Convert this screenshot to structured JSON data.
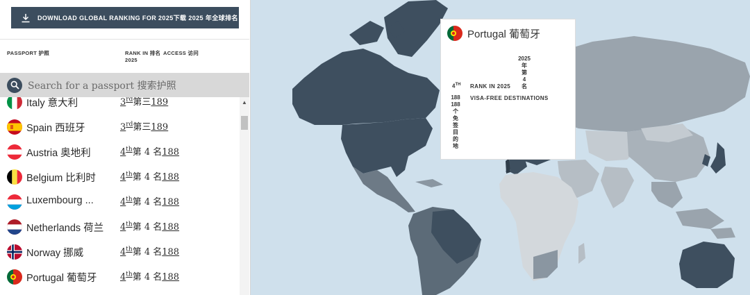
{
  "download_button": {
    "label": "DOWNLOAD GLOBAL RANKING FOR 2025下载 2025 年全球排名"
  },
  "table_header": {
    "passport": "PASSPORT 护照",
    "rank": "RANK IN 排名",
    "access": "ACCESS 访问",
    "year": "2025"
  },
  "search": {
    "placeholder": "Search for a passport 搜索护照"
  },
  "passports": [
    {
      "name": "Italy 意大利",
      "rank_num": "3",
      "rank_suffix": "rd",
      "rank_cn": "第三",
      "access": "189",
      "flag": "italy"
    },
    {
      "name": "Spain 西班牙",
      "rank_num": "3",
      "rank_suffix": "rd",
      "rank_cn": "第三",
      "access": "189",
      "flag": "spain"
    },
    {
      "name": "Austria 奥地利",
      "rank_num": "4",
      "rank_suffix": "th",
      "rank_cn": "第 4 名",
      "access": "188",
      "flag": "austria"
    },
    {
      "name": "Belgium 比利时",
      "rank_num": "4",
      "rank_suffix": "th",
      "rank_cn": "第 4 名",
      "access": "188",
      "flag": "belgium"
    },
    {
      "name": "Luxembourg ...",
      "rank_num": "4",
      "rank_suffix": "th",
      "rank_cn": "第 4 名",
      "access": "188",
      "flag": "luxembourg"
    },
    {
      "name": "Netherlands 荷兰",
      "rank_num": "4",
      "rank_suffix": "th",
      "rank_cn": "第 4 名",
      "access": "188",
      "flag": "netherlands"
    },
    {
      "name": "Norway 挪威",
      "rank_num": "4",
      "rank_suffix": "th",
      "rank_cn": "第 4 名",
      "access": "188",
      "flag": "norway"
    },
    {
      "name": "Portugal 葡萄牙",
      "rank_num": "4",
      "rank_suffix": "th",
      "rank_cn": "第 4 名",
      "access": "188",
      "flag": "portugal"
    }
  ],
  "tooltip": {
    "country": "Portugal 葡萄牙",
    "year_cn": [
      "2025",
      "年",
      "第",
      "4",
      "名"
    ],
    "rank_value": "4",
    "rank_suffix": "TH",
    "rank_label": "RANK IN 2025",
    "dest_value": "188",
    "dest_cn": [
      "188",
      "个",
      "免",
      "签",
      "目",
      "的",
      "地"
    ],
    "dest_label": "VISA-FREE DESTINATIONS"
  },
  "colors": {
    "ocean": "#cfe0ec",
    "dark_country": "#3e4f5f",
    "button_bg": "#3c4d5e"
  }
}
